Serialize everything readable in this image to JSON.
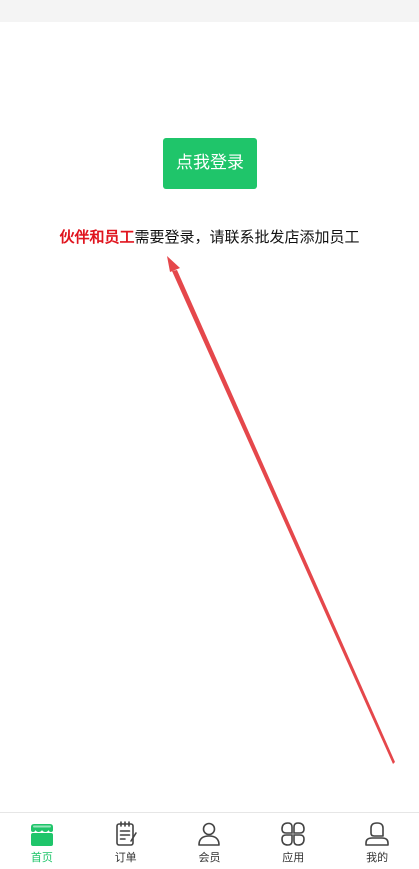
{
  "login_button": {
    "label": "点我登录"
  },
  "notice": {
    "highlight": "伙伴和员工",
    "rest": "需要登录，请联系批发店添加员工"
  },
  "colors": {
    "accent": "#1fc56a",
    "highlight": "#e0141e",
    "arrow": "#e5474b"
  },
  "tabs": [
    {
      "label": "首页",
      "icon": "store-icon",
      "active": true
    },
    {
      "label": "订单",
      "icon": "order-list-icon",
      "active": false
    },
    {
      "label": "会员",
      "icon": "member-icon",
      "active": false
    },
    {
      "label": "应用",
      "icon": "apps-grid-icon",
      "active": false
    },
    {
      "label": "我的",
      "icon": "profile-icon",
      "active": false
    }
  ]
}
